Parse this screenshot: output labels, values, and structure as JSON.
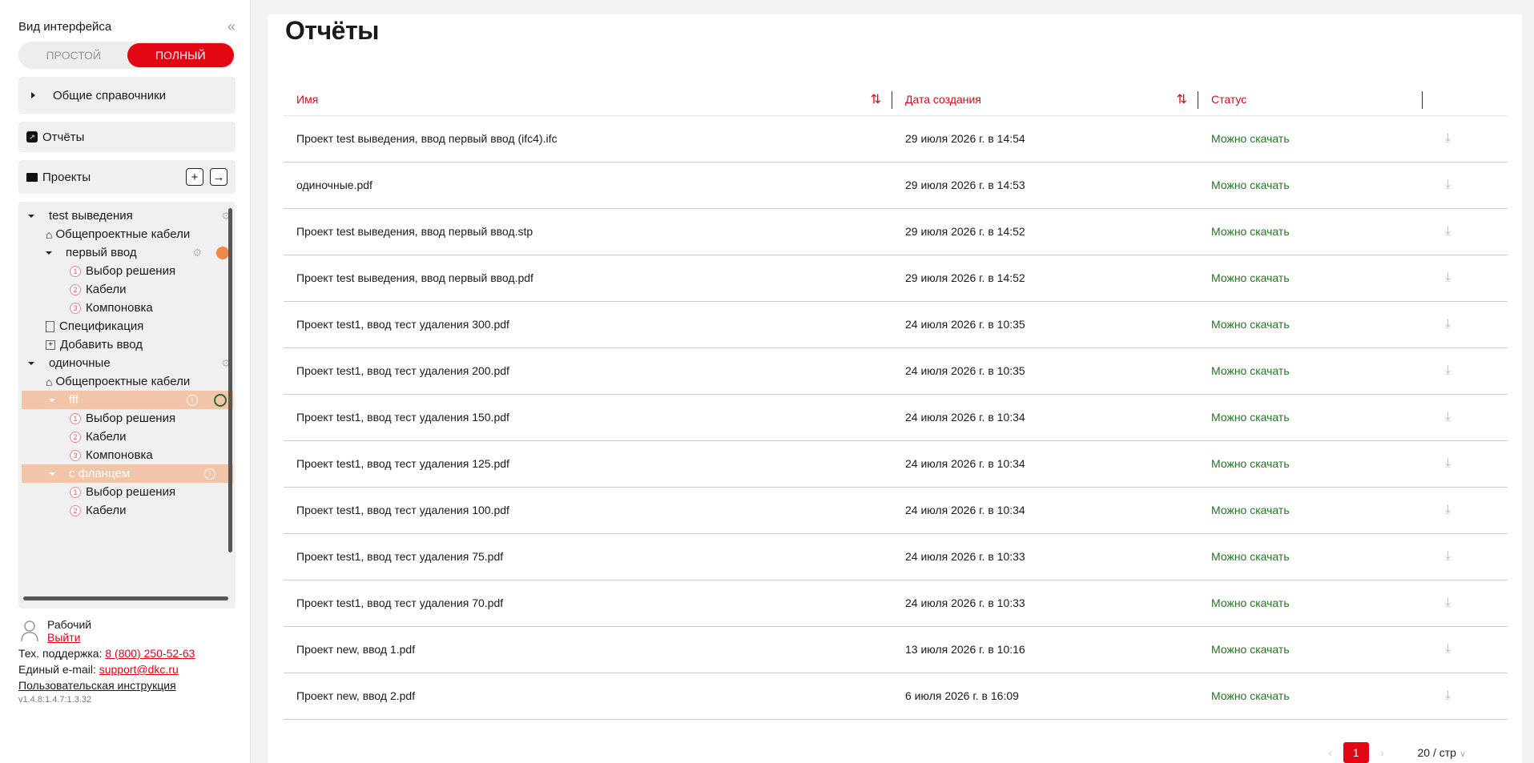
{
  "sidebar": {
    "view_title": "Вид интерфейса",
    "modes": [
      "ПРОСТОЙ",
      "ПОЛНЫЙ"
    ],
    "refs_label": "Общие справочники",
    "reports_label": "Отчёты",
    "projects_label": "Проекты",
    "tree": [
      {
        "label": "test выведения",
        "type": "project"
      },
      {
        "label": "Общепроектные кабели",
        "type": "home"
      },
      {
        "label": "первый ввод",
        "type": "input"
      },
      {
        "label": "Выбор решения",
        "type": "step",
        "num": "1"
      },
      {
        "label": "Кабели",
        "type": "step",
        "num": "2"
      },
      {
        "label": "Компоновка",
        "type": "step",
        "num": "3"
      },
      {
        "label": "Спецификация",
        "type": "doc"
      },
      {
        "label": "Добавить ввод",
        "type": "add"
      },
      {
        "label": "одиночные",
        "type": "project"
      },
      {
        "label": "Общепроектные кабели",
        "type": "home"
      },
      {
        "label": "fff",
        "type": "input-selected"
      },
      {
        "label": "Выбор решения",
        "type": "step",
        "num": "1"
      },
      {
        "label": "Кабели",
        "type": "step",
        "num": "2"
      },
      {
        "label": "Компоновка",
        "type": "step",
        "num": "3"
      },
      {
        "label": "с фланцем",
        "type": "input-selected"
      },
      {
        "label": "Выбор решения",
        "type": "step",
        "num": "1"
      },
      {
        "label": "Кабели",
        "type": "step",
        "num": "2"
      }
    ],
    "user_name": "Рабочий",
    "logout": "Выйти",
    "support_label": "Тех. поддержка:",
    "support_phone": "8 (800) 250-52-63",
    "email_label": "Единый e-mail:",
    "email": "support@dkc.ru",
    "manual": "Пользовательская инструкция",
    "version": "v1.4.8:1.4.7:1.3.32"
  },
  "main": {
    "title": "Отчёты",
    "columns": [
      "Имя",
      "Дата создания",
      "Статус"
    ],
    "rows": [
      {
        "name": "Проект test выведения, ввод первый ввод (ifc4).ifc",
        "date": "29 июля 2026 г. в 14:54",
        "status": "Можно скачать"
      },
      {
        "name": "одиночные.pdf",
        "date": "29 июля 2026 г. в 14:53",
        "status": "Можно скачать"
      },
      {
        "name": "Проект test выведения, ввод первый ввод.stp",
        "date": "29 июля 2026 г. в 14:52",
        "status": "Можно скачать"
      },
      {
        "name": "Проект test выведения, ввод первый ввод.pdf",
        "date": "29 июля 2026 г. в 14:52",
        "status": "Можно скачать"
      },
      {
        "name": "Проект test1, ввод тест удаления 300.pdf",
        "date": "24 июля 2026 г. в 10:35",
        "status": "Можно скачать"
      },
      {
        "name": "Проект test1, ввод тест удаления 200.pdf",
        "date": "24 июля 2026 г. в 10:35",
        "status": "Можно скачать"
      },
      {
        "name": "Проект test1, ввод тест удаления 150.pdf",
        "date": "24 июля 2026 г. в 10:34",
        "status": "Можно скачать"
      },
      {
        "name": "Проект test1, ввод тест удаления 125.pdf",
        "date": "24 июля 2026 г. в 10:34",
        "status": "Можно скачать"
      },
      {
        "name": "Проект test1, ввод тест удаления 100.pdf",
        "date": "24 июля 2026 г. в 10:34",
        "status": "Можно скачать"
      },
      {
        "name": "Проект test1, ввод тест удаления 75.pdf",
        "date": "24 июля 2026 г. в 10:33",
        "status": "Можно скачать"
      },
      {
        "name": "Проект test1, ввод тест удаления 70.pdf",
        "date": "24 июля 2026 г. в 10:33",
        "status": "Можно скачать"
      },
      {
        "name": "Проект new, ввод 1.pdf",
        "date": "13 июля 2026 г. в 10:16",
        "status": "Можно скачать"
      },
      {
        "name": "Проект new, ввод 2.pdf",
        "date": "6 июля 2026 г. в 16:09",
        "status": "Можно скачать"
      }
    ],
    "pager": {
      "current": "1",
      "page_size": "20 / стр"
    }
  },
  "colors": {
    "accent": "#e20613",
    "status_ok": "#1e7a1e",
    "selected_row": "#f2c4a8"
  }
}
